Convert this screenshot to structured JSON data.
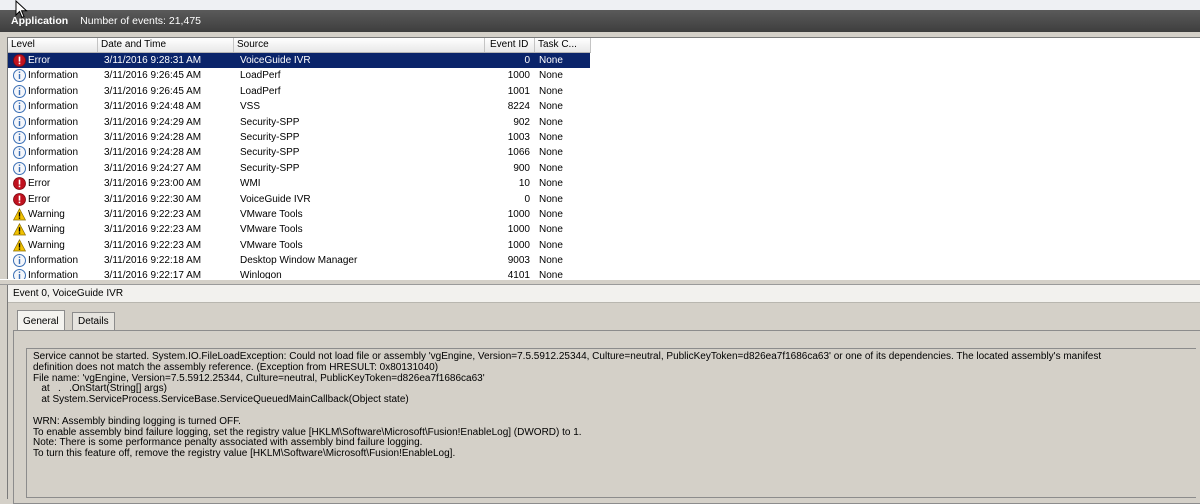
{
  "header": {
    "title": "Application",
    "count": "Number of events: 21,475"
  },
  "columns": [
    "Level",
    "Date and Time",
    "Source",
    "Event ID",
    "Task C..."
  ],
  "events": [
    {
      "level": "Error",
      "icon": "error-icon",
      "date": "3/11/2016 9:28:31 AM",
      "source": "VoiceGuide IVR",
      "id": "0",
      "task": "None",
      "selected": true
    },
    {
      "level": "Information",
      "icon": "info-icon",
      "date": "3/11/2016 9:26:45 AM",
      "source": "LoadPerf",
      "id": "1000",
      "task": "None"
    },
    {
      "level": "Information",
      "icon": "info-icon",
      "date": "3/11/2016 9:26:45 AM",
      "source": "LoadPerf",
      "id": "1001",
      "task": "None"
    },
    {
      "level": "Information",
      "icon": "info-icon",
      "date": "3/11/2016 9:24:48 AM",
      "source": "VSS",
      "id": "8224",
      "task": "None"
    },
    {
      "level": "Information",
      "icon": "info-icon",
      "date": "3/11/2016 9:24:29 AM",
      "source": "Security-SPP",
      "id": "902",
      "task": "None"
    },
    {
      "level": "Information",
      "icon": "info-icon",
      "date": "3/11/2016 9:24:28 AM",
      "source": "Security-SPP",
      "id": "1003",
      "task": "None"
    },
    {
      "level": "Information",
      "icon": "info-icon",
      "date": "3/11/2016 9:24:28 AM",
      "source": "Security-SPP",
      "id": "1066",
      "task": "None"
    },
    {
      "level": "Information",
      "icon": "info-icon",
      "date": "3/11/2016 9:24:27 AM",
      "source": "Security-SPP",
      "id": "900",
      "task": "None"
    },
    {
      "level": "Error",
      "icon": "error-icon",
      "date": "3/11/2016 9:23:00 AM",
      "source": "WMI",
      "id": "10",
      "task": "None"
    },
    {
      "level": "Error",
      "icon": "error-icon",
      "date": "3/11/2016 9:22:30 AM",
      "source": "VoiceGuide IVR",
      "id": "0",
      "task": "None"
    },
    {
      "level": "Warning",
      "icon": "warning-icon",
      "date": "3/11/2016 9:22:23 AM",
      "source": "VMware Tools",
      "id": "1000",
      "task": "None"
    },
    {
      "level": "Warning",
      "icon": "warning-icon",
      "date": "3/11/2016 9:22:23 AM",
      "source": "VMware Tools",
      "id": "1000",
      "task": "None"
    },
    {
      "level": "Warning",
      "icon": "warning-icon",
      "date": "3/11/2016 9:22:23 AM",
      "source": "VMware Tools",
      "id": "1000",
      "task": "None"
    },
    {
      "level": "Information",
      "icon": "info-icon",
      "date": "3/11/2016 9:22:18 AM",
      "source": "Desktop Window Manager",
      "id": "9003",
      "task": "None"
    },
    {
      "level": "Information",
      "icon": "info-icon",
      "date": "3/11/2016 9:22:17 AM",
      "source": "Winlogon",
      "id": "4101",
      "task": "None"
    }
  ],
  "detail": {
    "title": "Event 0, VoiceGuide IVR",
    "tabs": [
      "General",
      "Details"
    ],
    "message": [
      "Service cannot be started. System.IO.FileLoadException: Could not load file or assembly 'vgEngine, Version=7.5.5912.25344, Culture=neutral, PublicKeyToken=d826ea7f1686ca63' or one of its dependencies. The located assembly's manifest",
      "definition does not match the assembly reference. (Exception from HRESULT: 0x80131040)",
      "File name: 'vgEngine, Version=7.5.5912.25344, Culture=neutral, PublicKeyToken=d826ea7f1686ca63'",
      "   at   .   .OnStart(String[] args)",
      "   at System.ServiceProcess.ServiceBase.ServiceQueuedMainCallback(Object state)",
      "",
      "WRN: Assembly binding logging is turned OFF.",
      "To enable assembly bind failure logging, set the registry value [HKLM\\Software\\Microsoft\\Fusion!EnableLog] (DWORD) to 1.",
      "Note: There is some performance penalty associated with assembly bind failure logging.",
      "To turn this feature off, remove the registry value [HKLM\\Software\\Microsoft\\Fusion!EnableLog]."
    ]
  },
  "colors": {
    "selection": "#0a246a",
    "error": "#c0121f",
    "info": "#3a6fb5",
    "warning": "#f2c200"
  }
}
